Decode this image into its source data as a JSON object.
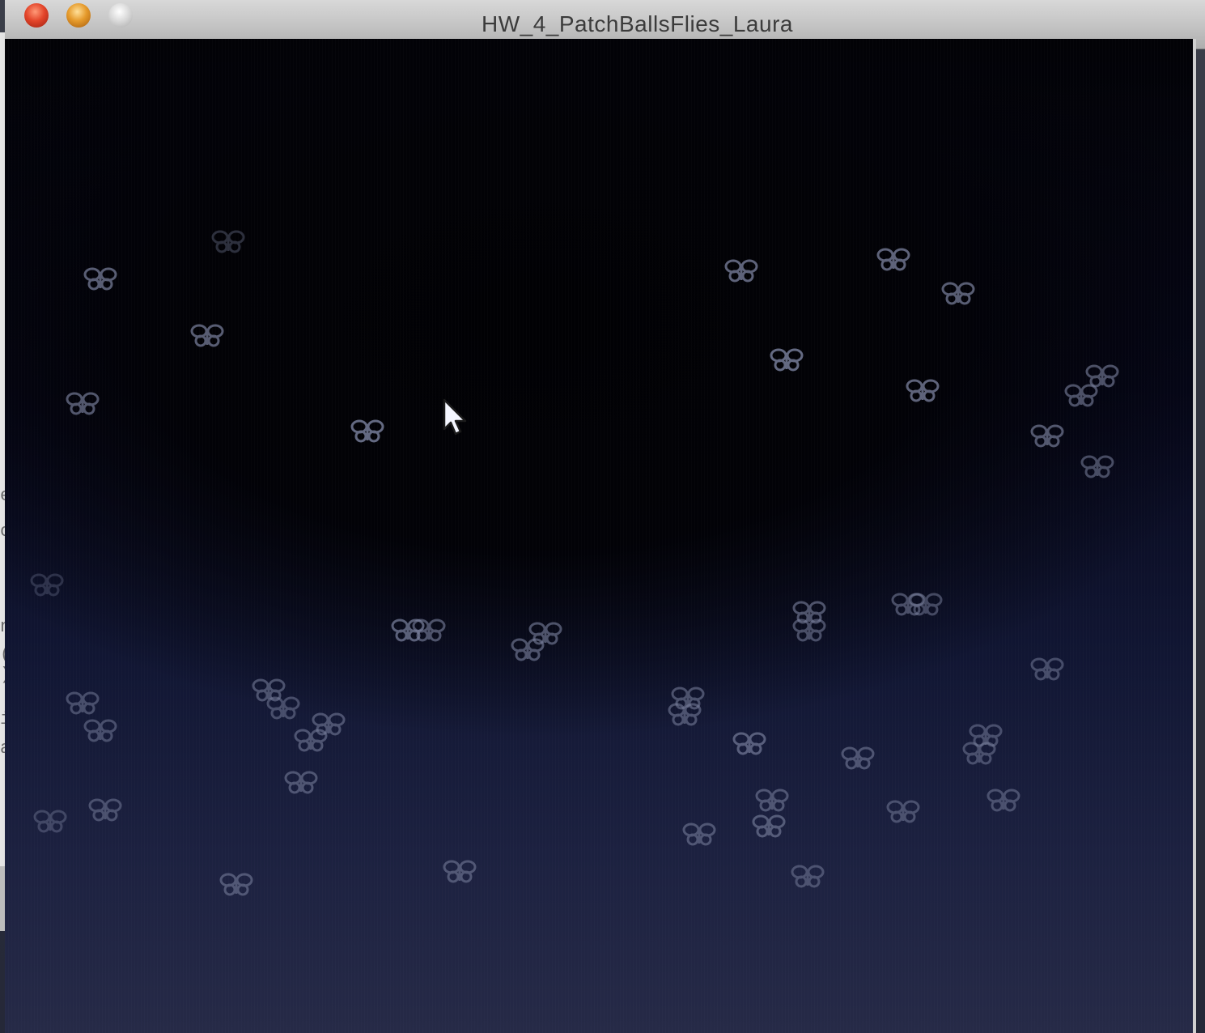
{
  "window": {
    "title": "HW_4_PatchBallsFlies_Laura",
    "buttons": [
      "close-icon",
      "minimize-icon",
      "zoom-icon"
    ]
  },
  "sketch": {
    "background_top": "#020206",
    "background_bottom": "#262a47",
    "fly_color": "#7c83a0",
    "fly_icon": "butterfly-icon",
    "cursor_icon": "arrow-cursor-icon"
  },
  "background_window": {
    "text_fragments": [
      "e",
      "o",
      "nd",
      "( )",
      "in",
      "al"
    ]
  }
}
